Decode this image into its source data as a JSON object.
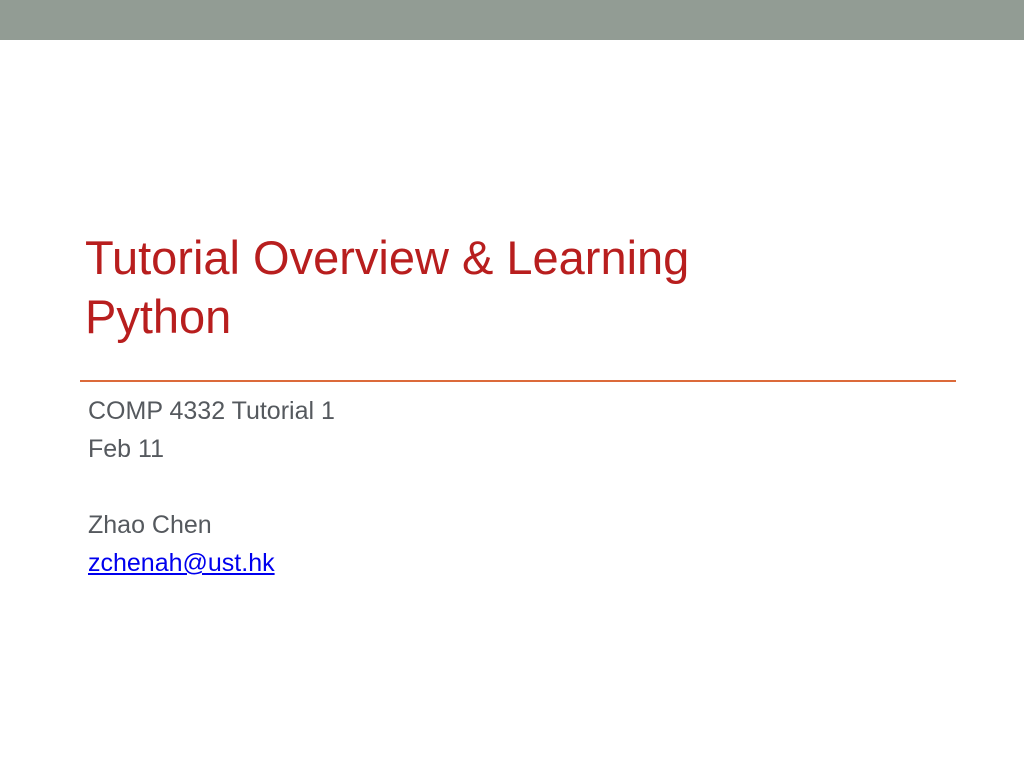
{
  "slide": {
    "title_lines": [
      "Tutorial Overview & Learning",
      "Python"
    ],
    "subtitle": {
      "course": "COMP 4332 Tutorial 1",
      "date": "Feb 11",
      "author": "Zhao Chen",
      "email": "zchenah@ust.hk"
    }
  },
  "colors": {
    "top_bar": "#929c94",
    "title": "#b81e1e",
    "divider": "#dc6a3a",
    "body_text": "#55595e",
    "link": "#0000ee"
  }
}
